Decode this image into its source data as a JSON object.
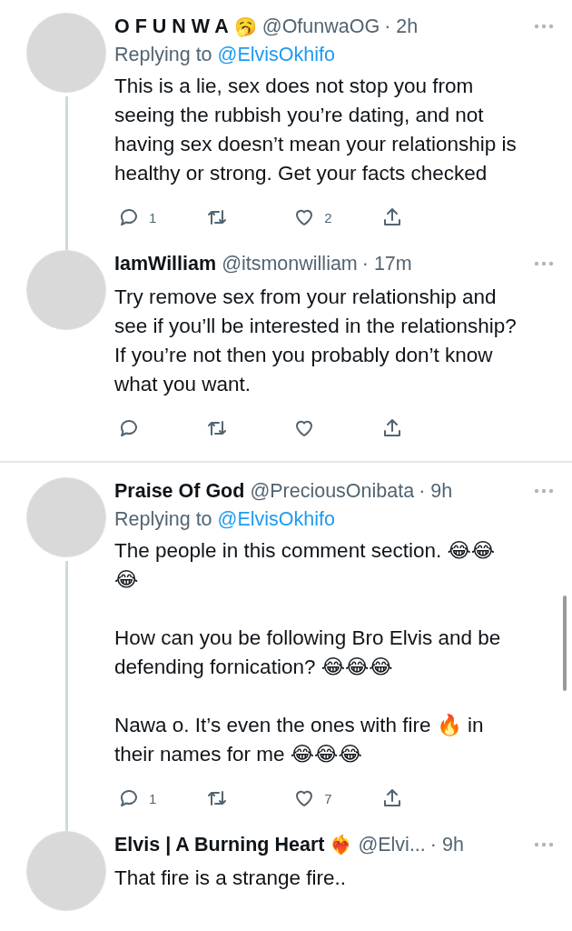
{
  "tweets": [
    {
      "name": "O F U N W A",
      "name_emoji": "🥱",
      "handle": "@OfunwaOG",
      "time": "· 2h",
      "replying": {
        "prefix": "Replying to",
        "handle": "@ElvisOkhifo"
      },
      "body": [
        "This is a lie, sex does not stop you from seeing the rubbish you’re dating, and not having sex doesn’t mean your relationship is healthy or strong. Get your facts checked"
      ],
      "thread_line": true,
      "divider": false,
      "actions": [
        {
          "kind": "reply",
          "count": "1"
        },
        {
          "kind": "retweet"
        },
        {
          "kind": "like",
          "count": "2"
        },
        {
          "kind": "share"
        }
      ]
    },
    {
      "name": "IamWilliam",
      "handle": "@itsmonwilliam",
      "time": "· 17m",
      "body": [
        "Try remove sex from your relationship and see if you’ll be interested in the relationship? If you’re not then you probably don’t know what you want."
      ],
      "thread_line": false,
      "divider": true,
      "actions": [
        {
          "kind": "reply"
        },
        {
          "kind": "retweet"
        },
        {
          "kind": "like"
        },
        {
          "kind": "share"
        }
      ]
    },
    {
      "name": "Praise Of God",
      "handle": "@PreciousOnibata",
      "time": "· 9h",
      "replying": {
        "prefix": "Replying to",
        "handle": "@ElvisOkhifo"
      },
      "body": [
        "The people in this comment section. 😂😂😂",
        "How can you be following Bro Elvis and be defending fornication? 😂😂😂",
        "Nawa o. It’s even the ones with fire 🔥 in their names for me 😂😂😂"
      ],
      "thread_line": true,
      "divider": false,
      "actions": [
        {
          "kind": "reply",
          "count": "1"
        },
        {
          "kind": "retweet"
        },
        {
          "kind": "like",
          "count": "7"
        },
        {
          "kind": "share"
        }
      ]
    },
    {
      "name": "Elvis | A Burning Heart",
      "name_emoji": "❤️‍🔥",
      "handle": "@Elvi...",
      "time": "· 9h",
      "body": [
        "That fire is a strange fire.."
      ],
      "thread_line": false,
      "divider": false
    }
  ]
}
